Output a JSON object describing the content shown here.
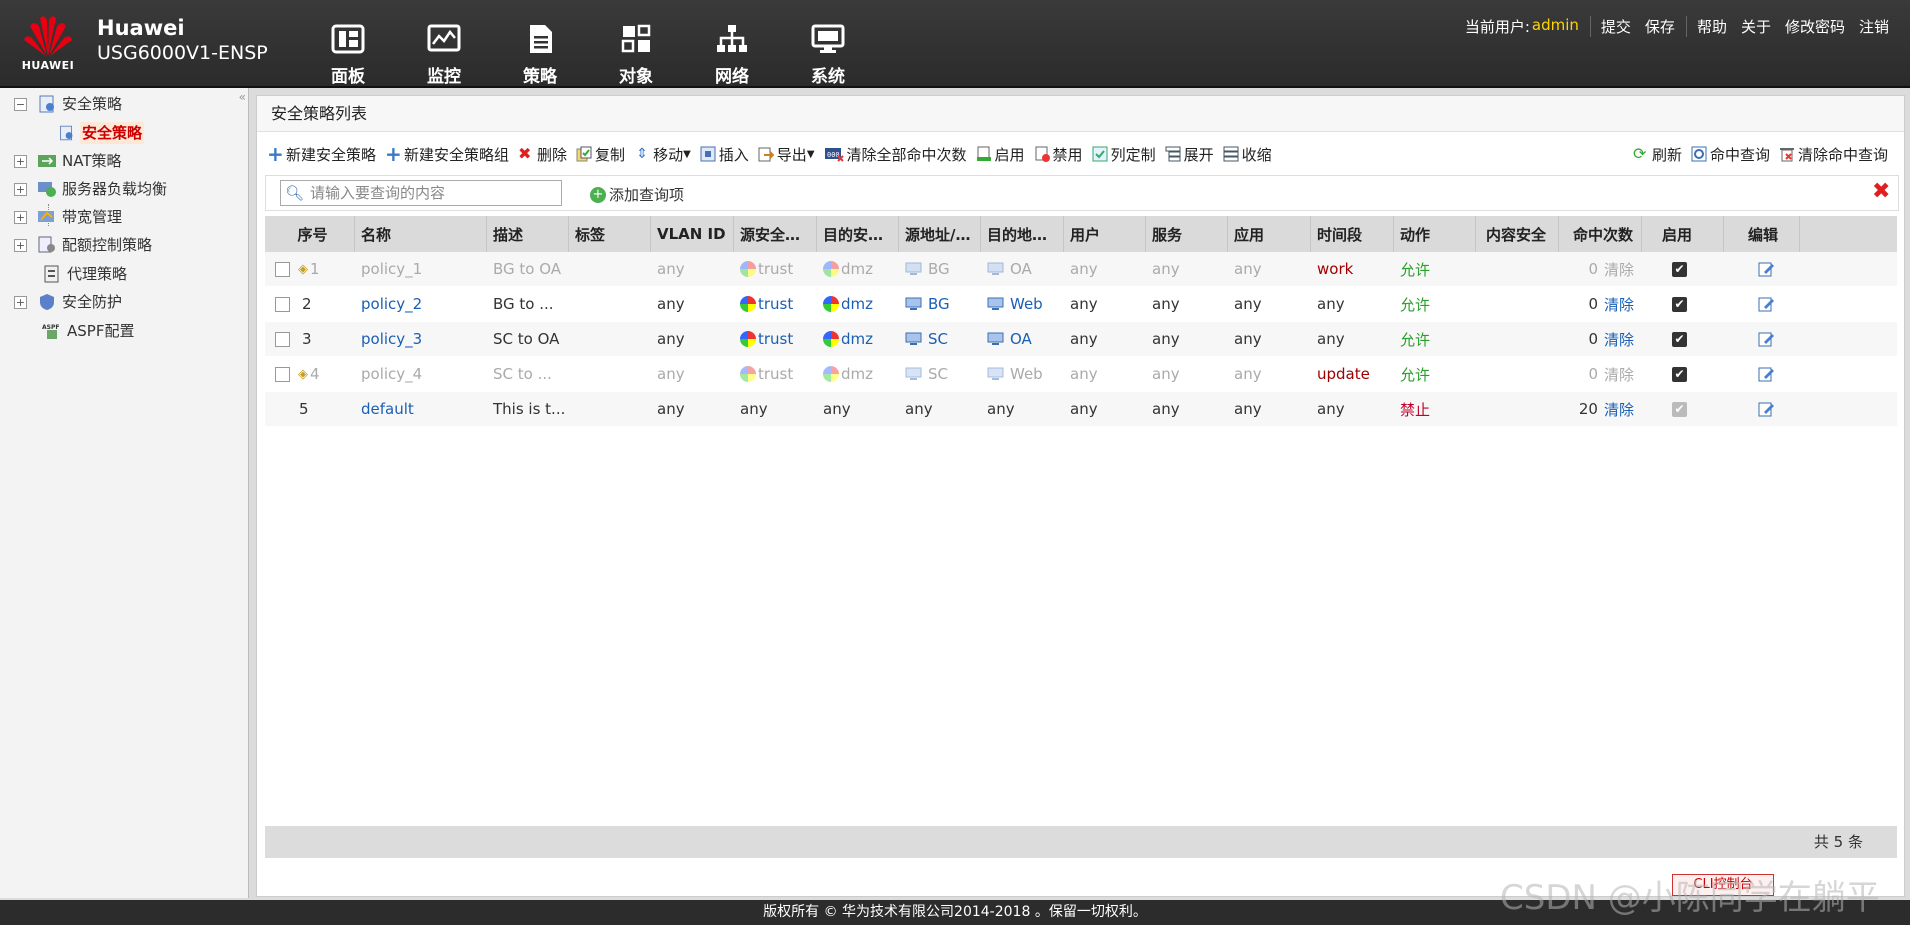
{
  "header": {
    "brand_logo_text": "HUAWEI",
    "brand_name": "Huawei",
    "model": "USG6000V1-ENSP",
    "nav": [
      {
        "label": "面板",
        "icon": "dashboard-icon"
      },
      {
        "label": "监控",
        "icon": "monitor-icon"
      },
      {
        "label": "策略",
        "icon": "policy-icon"
      },
      {
        "label": "对象",
        "icon": "object-icon"
      },
      {
        "label": "网络",
        "icon": "network-icon"
      },
      {
        "label": "系统",
        "icon": "system-icon"
      }
    ],
    "current_user_label": "当前用户:",
    "user": "admin",
    "links": [
      "提交",
      "保存",
      "帮助",
      "关于",
      "修改密码",
      "注销"
    ]
  },
  "sidebar": {
    "items": [
      {
        "label": "安全策略",
        "expander": "−"
      },
      {
        "label": "安全策略"
      },
      {
        "label": "NAT策略",
        "expander": "+"
      },
      {
        "label": "服务器负载均衡",
        "expander": "+"
      },
      {
        "label": "带宽管理",
        "expander": "+"
      },
      {
        "label": "配额控制策略",
        "expander": "+"
      },
      {
        "label": "代理策略"
      },
      {
        "label": "安全防护",
        "expander": "+"
      },
      {
        "label": "ASPF配置"
      }
    ]
  },
  "main": {
    "title": "安全策略列表",
    "toolbar": [
      "新建安全策略",
      "新建安全策略组",
      "删除",
      "复制",
      "移动",
      "插入",
      "导出",
      "清除全部命中次数",
      "启用",
      "禁用",
      "列定制",
      "展开",
      "收缩"
    ],
    "toolbar_right": [
      "刷新",
      "命中查询",
      "清除命中查询"
    ],
    "search_placeholder": "请输入要查询的内容",
    "add_query": "添加查询项",
    "columns": [
      "序号",
      "名称",
      "描述",
      "标签",
      "VLAN ID",
      "源安全…",
      "目的安…",
      "源地址/…",
      "目的地…",
      "用户",
      "服务",
      "应用",
      "时间段",
      "动作",
      "内容安全",
      "命中次数",
      "启用",
      "编辑"
    ],
    "rows": [
      {
        "seq": "1",
        "name": "policy_1",
        "desc": "BG to OA",
        "vlan": "any",
        "src_zone": "trust",
        "dst_zone": "dmz",
        "src_addr": "BG",
        "dst_addr": "OA",
        "user": "any",
        "service": "any",
        "app": "any",
        "time": "work",
        "action": "允许",
        "hits": "0",
        "clear": "清除",
        "disabled": true
      },
      {
        "seq": "2",
        "name": "policy_2",
        "desc": "BG to ...",
        "vlan": "any",
        "src_zone": "trust",
        "dst_zone": "dmz",
        "src_addr": "BG",
        "dst_addr": "Web",
        "user": "any",
        "service": "any",
        "app": "any",
        "time": "any",
        "action": "允许",
        "hits": "0",
        "clear": "清除",
        "disabled": false
      },
      {
        "seq": "3",
        "name": "policy_3",
        "desc": "SC to OA",
        "vlan": "any",
        "src_zone": "trust",
        "dst_zone": "dmz",
        "src_addr": "SC",
        "dst_addr": "OA",
        "user": "any",
        "service": "any",
        "app": "any",
        "time": "any",
        "action": "允许",
        "hits": "0",
        "clear": "清除",
        "disabled": false
      },
      {
        "seq": "4",
        "name": "policy_4",
        "desc": "SC to ...",
        "vlan": "any",
        "src_zone": "trust",
        "dst_zone": "dmz",
        "src_addr": "SC",
        "dst_addr": "Web",
        "user": "any",
        "service": "any",
        "app": "any",
        "time": "update",
        "action": "允许",
        "hits": "0",
        "clear": "清除",
        "disabled": true
      },
      {
        "seq": "5",
        "name": "default",
        "desc": "This is t...",
        "vlan": "any",
        "src_zone": "any",
        "dst_zone": "any",
        "src_addr": "any",
        "dst_addr": "any",
        "user": "any",
        "service": "any",
        "app": "any",
        "time": "any",
        "action": "禁止",
        "hits": "20",
        "clear": "清除",
        "disabled": false
      }
    ],
    "total": "共 5 条"
  },
  "footer": {
    "copyright": "版权所有 © 华为技术有限公司2014-2018 。保留一切权利。",
    "console": "CLI控制台"
  },
  "watermark": "CSDN @小陈同学在躺平"
}
